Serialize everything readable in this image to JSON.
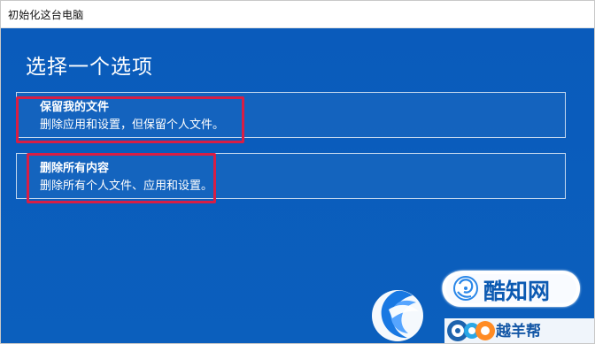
{
  "window": {
    "title": "初始化这台电脑"
  },
  "screen": {
    "heading": "选择一个选项"
  },
  "options": [
    {
      "title": "保留我的文件",
      "description": "删除应用和设置，但保留个人文件。"
    },
    {
      "title": "删除所有内容",
      "description": "删除所有个人文件、应用和设置。"
    }
  ],
  "watermark": {
    "brand": "酷知网",
    "secondary_brand": "越羊帮"
  },
  "colors": {
    "background_blue": "#0b5fbd",
    "highlight_red": "#d81e45",
    "title_bar": "#ffffff"
  }
}
